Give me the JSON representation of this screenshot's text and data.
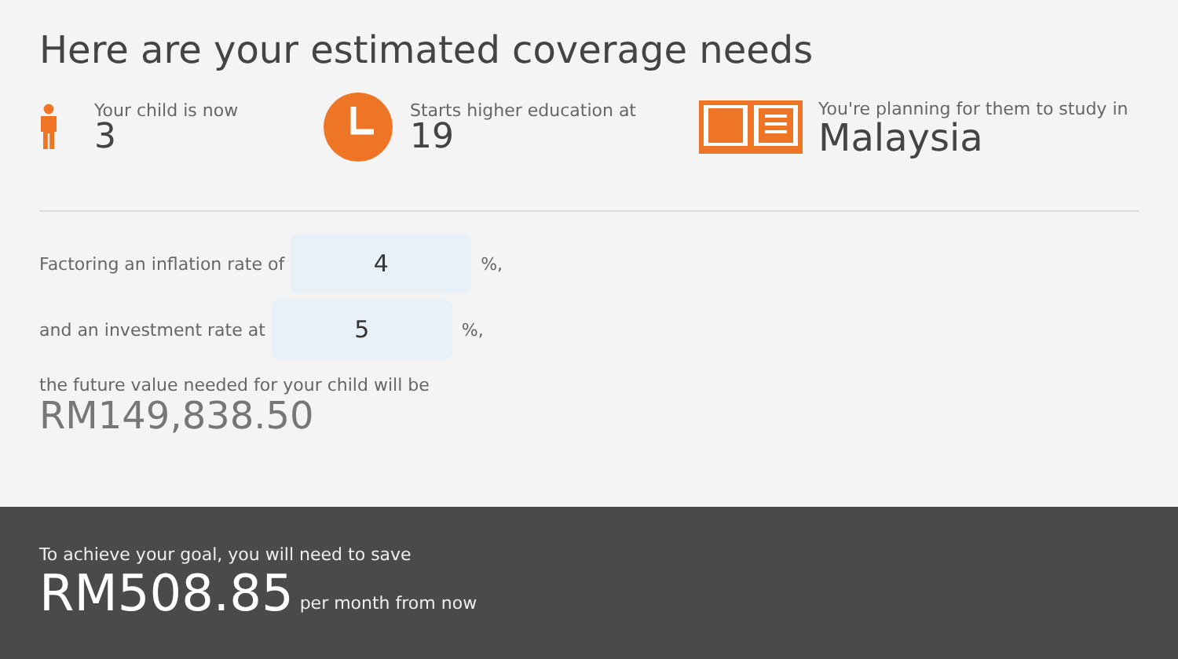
{
  "title": "Here are your estimated coverage needs",
  "stats": [
    {
      "kind": "person",
      "label": "Your child is now",
      "value": "3"
    },
    {
      "kind": "clock",
      "label": "Starts higher education at",
      "value": "19"
    },
    {
      "kind": "book",
      "label": "You're planning for them to study in",
      "value": "Malaysia"
    }
  ],
  "rates": [
    {
      "label": "Factoring an inflation rate of",
      "value": "4",
      "unit": "%,"
    },
    {
      "label": "and an investment rate at",
      "value": "5",
      "unit": "%,"
    }
  ],
  "future": {
    "label": "the future value needed for your child will be",
    "value": "RM149,838.50"
  },
  "savings": {
    "label": "To achieve your goal, you will need to save",
    "value": "RM508.85",
    "suffix": "per month from now"
  }
}
